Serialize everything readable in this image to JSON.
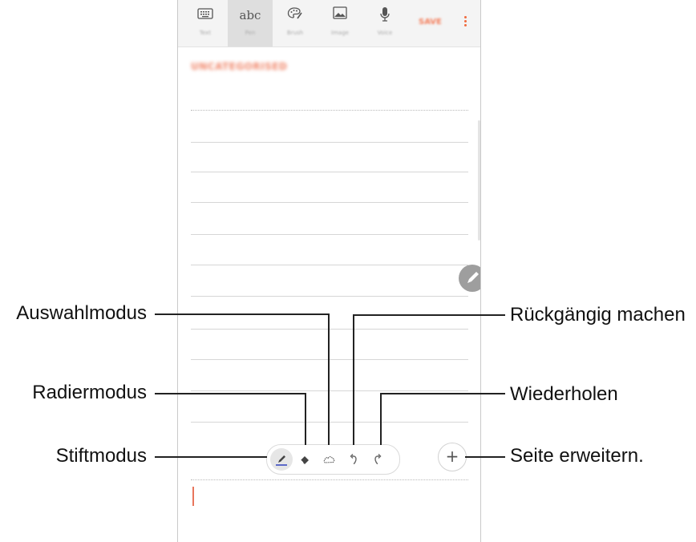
{
  "toolbar": {
    "items": [
      {
        "label": "Text",
        "icon": "keyboard-icon"
      },
      {
        "label": "Pen",
        "icon": "handwriting-abc-icon",
        "glyph": "abc",
        "active": true
      },
      {
        "label": "Brush",
        "icon": "palette-brush-icon"
      },
      {
        "label": "Image",
        "icon": "image-icon"
      },
      {
        "label": "Voice",
        "icon": "microphone-icon"
      }
    ],
    "save_label": "SAVE",
    "more_icon": "more-vertical-icon"
  },
  "note": {
    "title": "UNCATEGORISED",
    "accent_color": "#f0876b"
  },
  "pen_toolbar": {
    "tools": [
      {
        "name": "pen-mode",
        "icon": "pen-icon",
        "active": true
      },
      {
        "name": "eraser-mode",
        "icon": "eraser-icon"
      },
      {
        "name": "selection-mode",
        "icon": "lasso-cloud-icon"
      },
      {
        "name": "undo",
        "icon": "undo-icon"
      },
      {
        "name": "redo",
        "icon": "redo-icon"
      }
    ],
    "expand_label": "+"
  },
  "annotations": {
    "auswahlmodus": "Auswahlmodus",
    "radiermodus": "Radiermodus",
    "stiftmodus": "Stiftmodus",
    "rueckgaengig": "Rückgängig machen",
    "wiederholen": "Wiederholen",
    "seite_erweitern": "Seite erweitern."
  }
}
